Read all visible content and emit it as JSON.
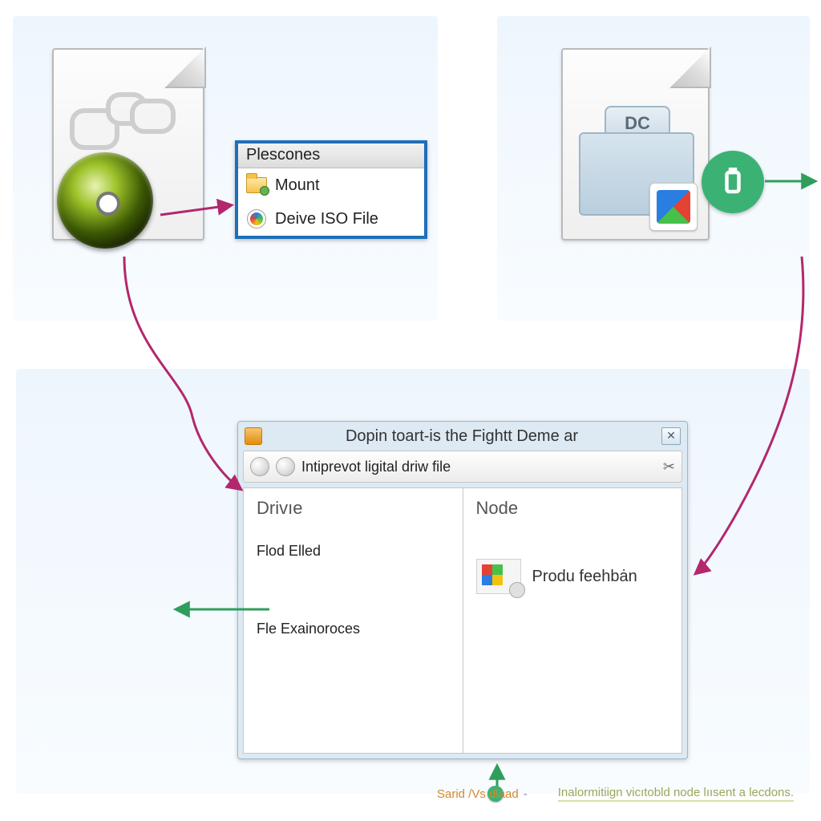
{
  "context_menu": {
    "title": "Plescones",
    "items": [
      {
        "label": "Mount"
      },
      {
        "label": "Deive ISO File"
      }
    ]
  },
  "dc_icon": {
    "label": "DC"
  },
  "window": {
    "title": "Dopin toart-is the Fightt Deme ar",
    "toolbar_text": "Intiprevot ligital driw file",
    "left_heading": "Drivıe",
    "right_heading": "Node",
    "left_items": [
      "Flod  Elled",
      "Fle Exainoroces"
    ],
    "node_item_label": "Produ feehbȧn"
  },
  "caption": {
    "part1": "Sarid /Vs dlaad",
    "dash": "-",
    "part2": "Inalormitiign vicıtobld node lıısent a lecdons."
  },
  "colors": {
    "accent_green": "#3bb273",
    "accent_blue": "#1e6fb8",
    "arrow_magenta": "#b3276d",
    "arrow_green": "#2f9e5b"
  }
}
